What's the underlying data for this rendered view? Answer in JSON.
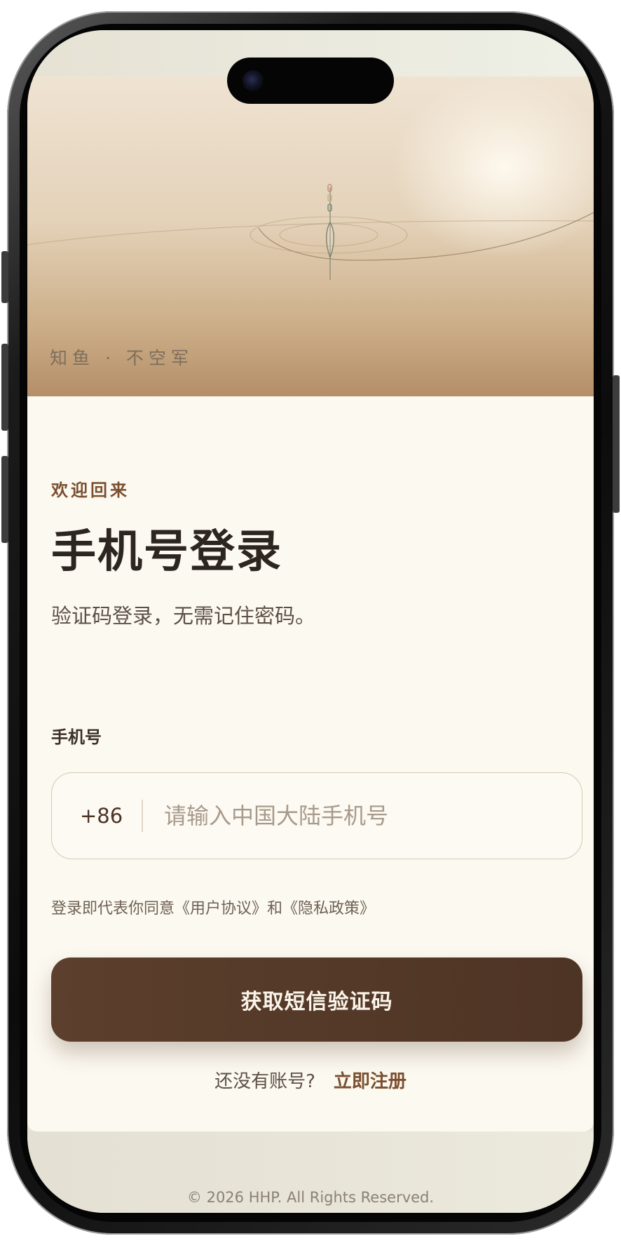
{
  "hero": {
    "tagline": "知鱼 · 不空军"
  },
  "login": {
    "welcome": "欢迎回来",
    "title": "手机号登录",
    "subtitle": "验证码登录，无需记住密码。",
    "phone_label": "手机号",
    "country_code": "+86",
    "phone_placeholder": "请输入中国大陆手机号",
    "phone_value": "",
    "agreement_prefix": "登录即代表你同意",
    "user_agreement_link": "《用户协议》",
    "agreement_and": "和",
    "privacy_policy_link": "《隐私政策》",
    "submit_label": "获取短信验证码",
    "register_prompt": "还没有账号?",
    "register_link": "立即注册"
  },
  "footer": {
    "copyright": "© 2026 HHP. All Rights Reserved."
  },
  "colors": {
    "accent_brown": "#7a4f2f",
    "button_brown": "#5c3f2c",
    "card_background": "#fcf9f1",
    "hero_gradient_end": "#b48e68"
  },
  "icons": {
    "hero_art": "fishing-float-ripple-icon"
  }
}
